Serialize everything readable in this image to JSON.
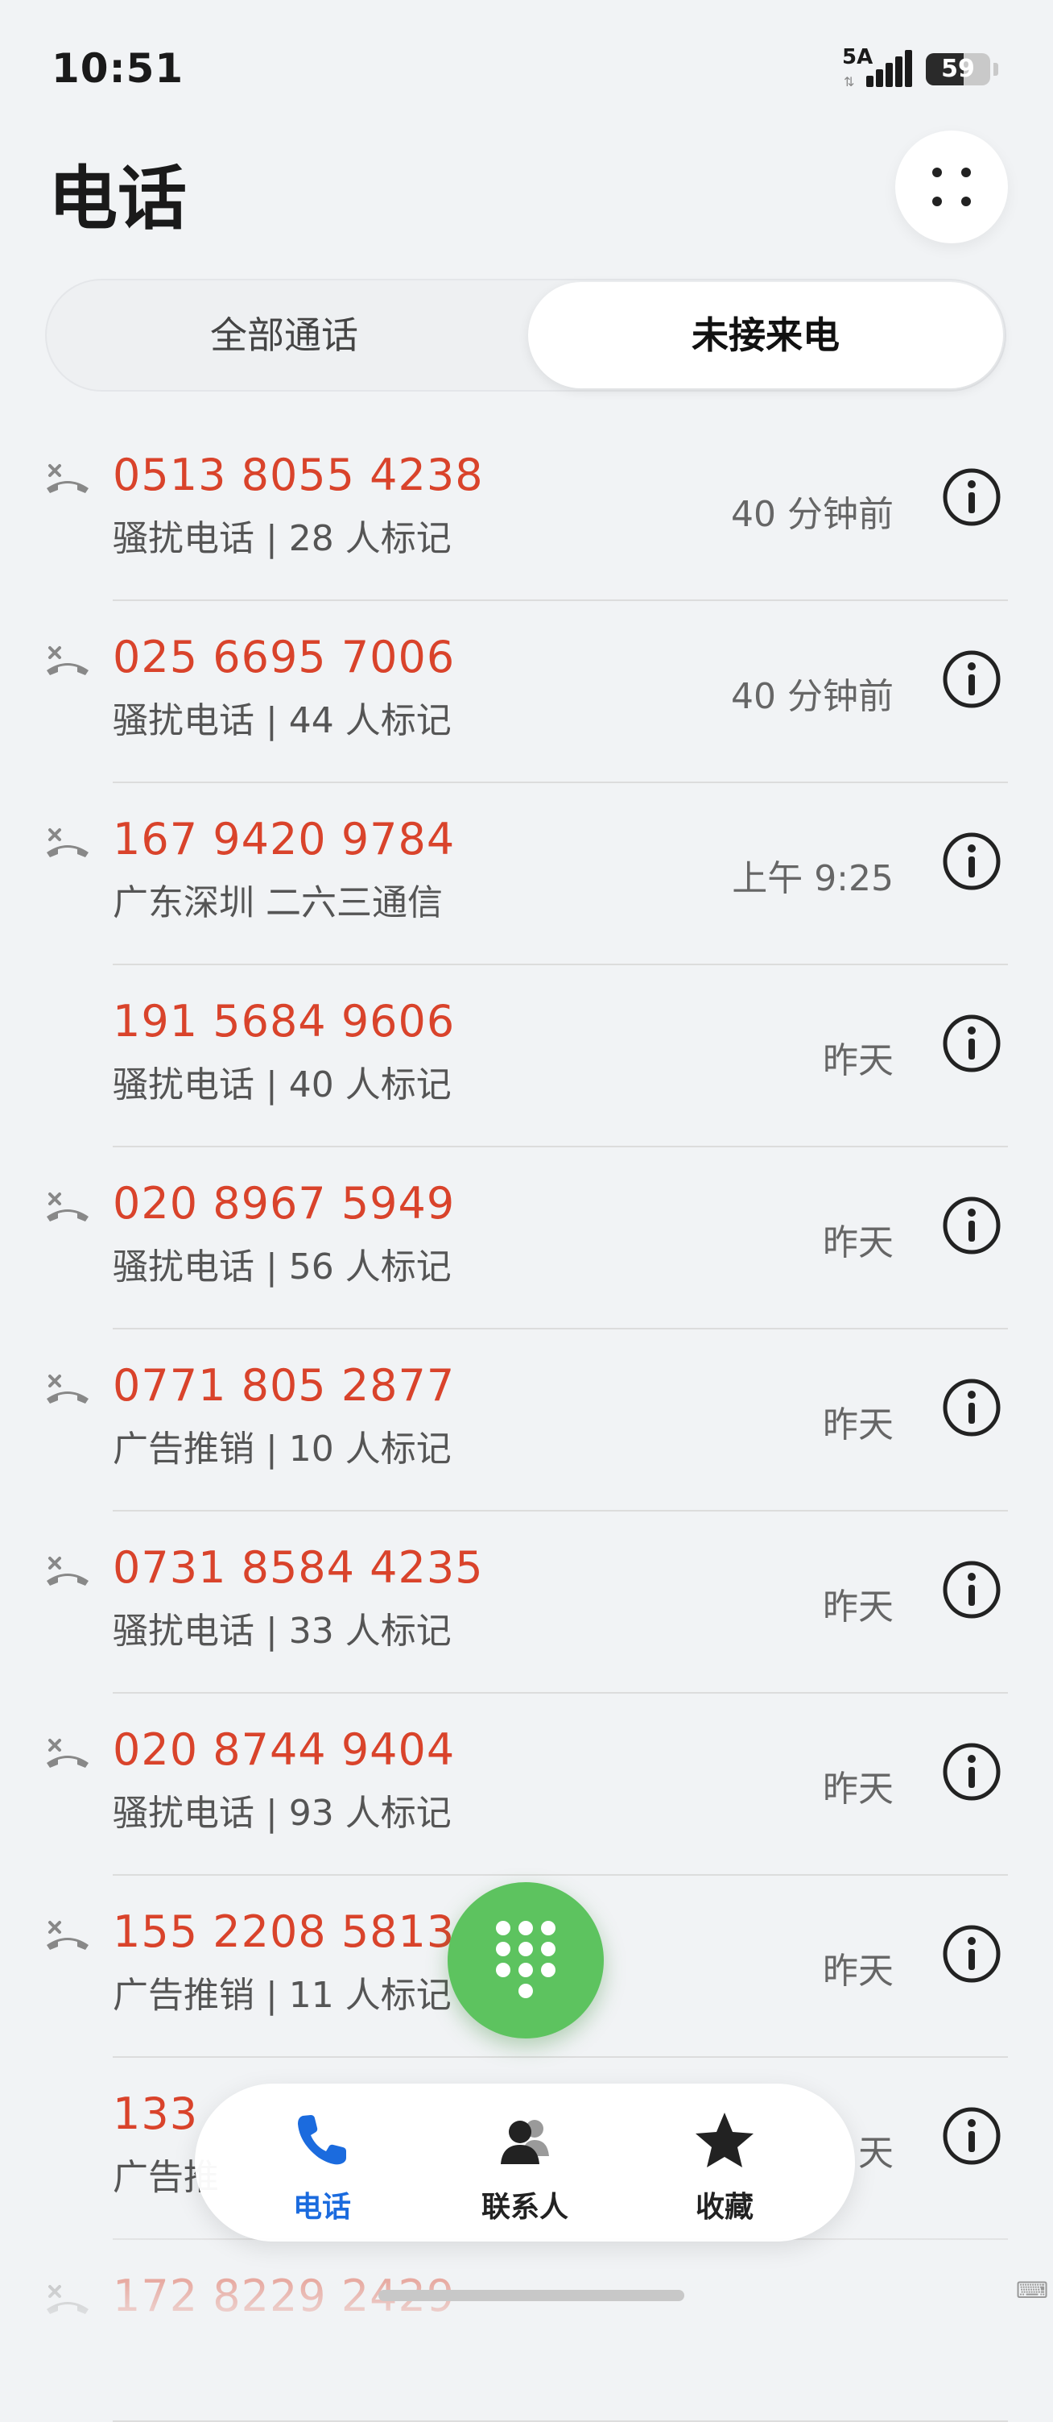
{
  "status": {
    "time": "10:51",
    "network": "5A",
    "battery": "59",
    "battery_level": 0.59
  },
  "header": {
    "title": "电话"
  },
  "tabs": [
    {
      "label": "全部通话",
      "selected": false
    },
    {
      "label": "未接来电",
      "selected": true
    }
  ],
  "calls": [
    {
      "number": "0513 8055 4238",
      "desc": "骚扰电话 | 28 人标记",
      "time": "40 分钟前",
      "missed_icon": true
    },
    {
      "number": "025 6695 7006",
      "desc": "骚扰电话 | 44 人标记",
      "time": "40 分钟前",
      "missed_icon": true
    },
    {
      "number": "167 9420 9784",
      "desc": "广东深圳 二六三通信",
      "time": "上午 9:25",
      "missed_icon": true
    },
    {
      "number": "191 5684 9606",
      "desc": "骚扰电话 | 40 人标记",
      "time": "昨天",
      "missed_icon": false
    },
    {
      "number": "020 8967 5949",
      "desc": "骚扰电话 | 56 人标记",
      "time": "昨天",
      "missed_icon": true
    },
    {
      "number": "0771 805 2877",
      "desc": "广告推销 | 10 人标记",
      "time": "昨天",
      "missed_icon": true
    },
    {
      "number": "0731 8584 4235",
      "desc": "骚扰电话 | 33 人标记",
      "time": "昨天",
      "missed_icon": true
    },
    {
      "number": "020 8744 9404",
      "desc": "骚扰电话 | 93 人标记",
      "time": "昨天",
      "missed_icon": true
    },
    {
      "number": "155 2208 5813",
      "desc": "广告推销 | 11 人标记",
      "time": "昨天",
      "missed_icon": true
    },
    {
      "number": "133",
      "desc": "广告推",
      "time": "天",
      "missed_icon": false
    },
    {
      "number": "172 8229 2429",
      "desc": "",
      "time": "",
      "missed_icon": true
    }
  ],
  "nav": [
    {
      "label": "电话",
      "icon": "phone-icon",
      "active": true
    },
    {
      "label": "联系人",
      "icon": "contacts-icon",
      "active": false
    },
    {
      "label": "收藏",
      "icon": "star-icon",
      "active": false
    }
  ],
  "colors": {
    "missed_number": "#D9432B",
    "fab": "#5DC35F",
    "nav_active": "#1B6BDE",
    "background": "#F1F3F5"
  }
}
